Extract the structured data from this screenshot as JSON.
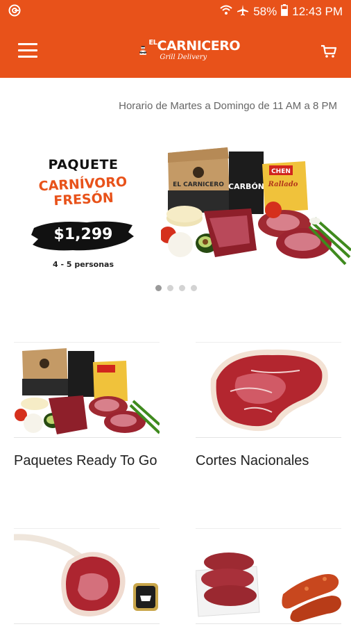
{
  "status_bar": {
    "battery": "58%",
    "time": "12:43 PM"
  },
  "app_bar": {
    "logo_small": "EL",
    "logo_text": "CARNICERO",
    "logo_tagline": "Grill Delivery"
  },
  "hours_text": "Horario de Martes a Domingo de 11 AM a 8 PM",
  "promo": {
    "title": "PAQUETE",
    "subtitle": "CARNÍVORO FRESÓN",
    "price": "$1,299",
    "persons": "4 - 5 personas",
    "box_label": "EL CARNICERO",
    "bag_label": "CARBÓN",
    "chips_brand": "CHEN",
    "chips_label": "Rallado"
  },
  "carousel": {
    "count": 4,
    "active": 0
  },
  "categories": [
    {
      "label": "Paquetes Ready To Go"
    },
    {
      "label": "Cortes Nacionales"
    },
    {
      "label": ""
    },
    {
      "label": ""
    }
  ],
  "colors": {
    "brand": "#e8521a",
    "text_dark": "#222222",
    "text_muted": "#666666"
  }
}
